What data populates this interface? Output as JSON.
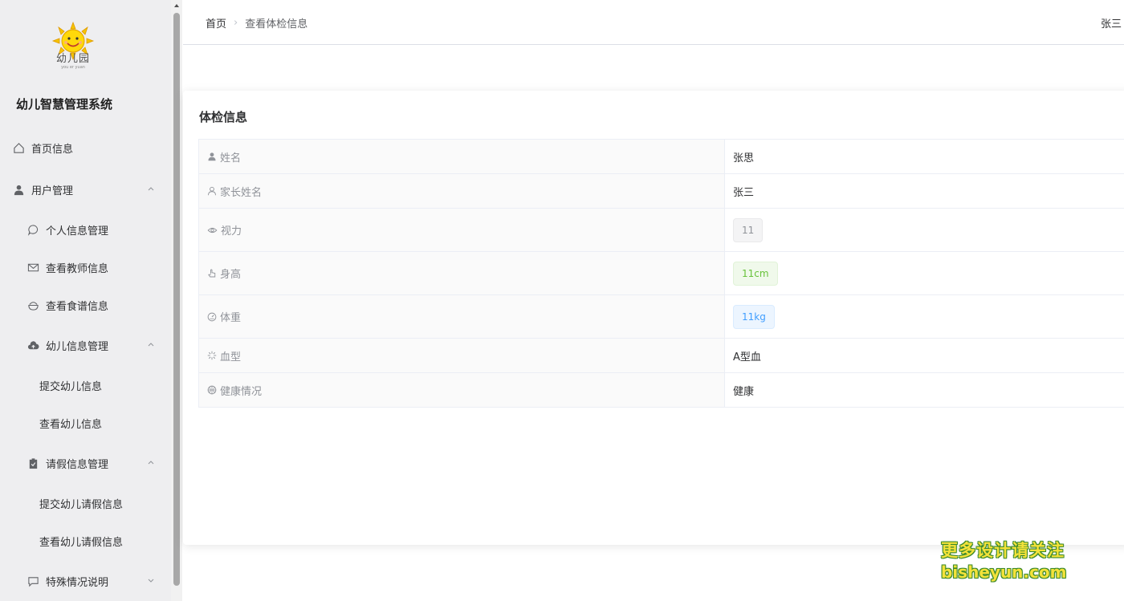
{
  "sidebar": {
    "logo_text": "幼儿园",
    "logo_sub": "you er yuan",
    "system_title": "幼儿智慧管理系统",
    "items": [
      {
        "label": "首页信息"
      },
      {
        "label": "用户管理"
      },
      {
        "label": "个人信息管理"
      },
      {
        "label": "查看教师信息"
      },
      {
        "label": "查看食谱信息"
      },
      {
        "label": "幼儿信息管理"
      },
      {
        "label": "提交幼儿信息"
      },
      {
        "label": "查看幼儿信息"
      },
      {
        "label": "请假信息管理"
      },
      {
        "label": "提交幼儿请假信息"
      },
      {
        "label": "查看幼儿请假信息"
      },
      {
        "label": "特殊情况说明"
      }
    ]
  },
  "header": {
    "breadcrumb": {
      "home": "首页",
      "separator": "›",
      "current": "查看体检信息"
    },
    "user_name": "张三"
  },
  "card": {
    "title": "体检信息",
    "rows": [
      {
        "label": "姓名",
        "value": "张思",
        "icon": "user-filled-icon"
      },
      {
        "label": "家长姓名",
        "value": "张三",
        "icon": "user-outline-icon"
      },
      {
        "label": "视力",
        "value": "11",
        "icon": "eye-icon",
        "tag": "info"
      },
      {
        "label": "身高",
        "value": "11cm",
        "icon": "pointer-hand-icon",
        "tag": "success"
      },
      {
        "label": "体重",
        "value": "11kg",
        "icon": "gauge-icon",
        "tag": "primary"
      },
      {
        "label": "血型",
        "value": "A型血",
        "icon": "sunburst-icon"
      },
      {
        "label": "健康情况",
        "value": "健康",
        "icon": "basketball-icon"
      }
    ]
  },
  "watermark": {
    "line1": "更多设计请关注",
    "line2": "bisheyun.com"
  },
  "colors": {
    "sidebar_bg": "#eeeef0",
    "accent_success": "#67c23a",
    "accent_primary": "#409eff",
    "accent_info": "#909399"
  }
}
